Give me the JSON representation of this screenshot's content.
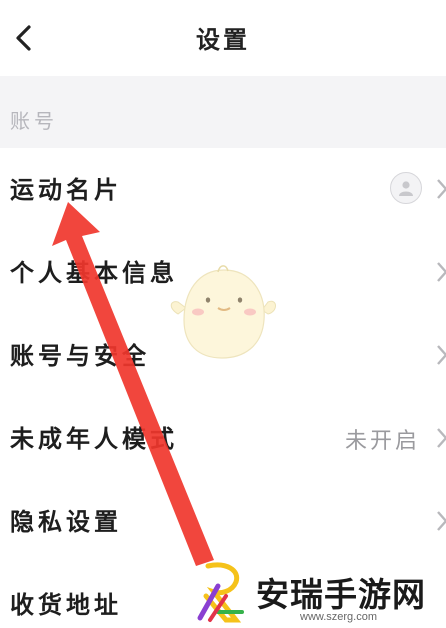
{
  "header": {
    "title": "设置",
    "back_icon": "chevron-left-icon"
  },
  "section": {
    "label": "账号"
  },
  "rows": [
    {
      "label": "运动名片",
      "value": "",
      "trailing_icon": "avatar-icon"
    },
    {
      "label": "个人基本信息",
      "value": ""
    },
    {
      "label": "账号与安全",
      "value": ""
    },
    {
      "label": "未成年人模式",
      "value": "未开启"
    },
    {
      "label": "隐私设置",
      "value": ""
    },
    {
      "label": "收货地址",
      "value": ""
    }
  ],
  "overlay": {
    "arrow_color": "#f0362d",
    "mascot_icon": "chick-mascot-icon"
  },
  "watermark": {
    "text": "安瑞手游网",
    "url": "www.szerg.com"
  },
  "colors": {
    "section_bg": "#f4f4f6",
    "label": "#1e1e1e",
    "muted": "#9a9a9e"
  }
}
